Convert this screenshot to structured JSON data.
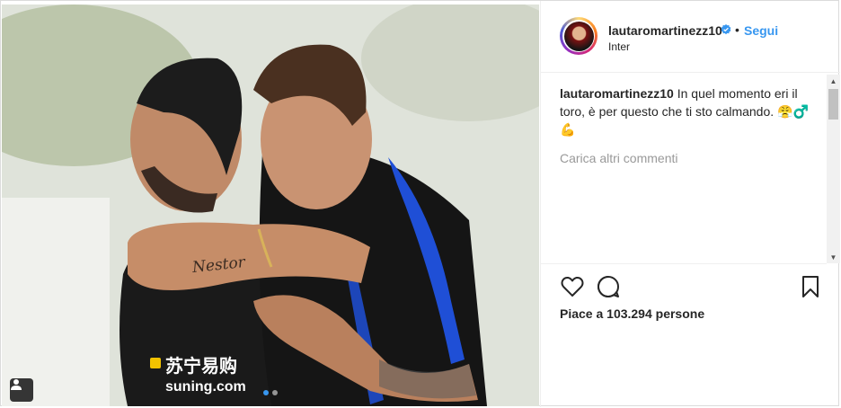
{
  "post": {
    "username": "lautaromartinezz10",
    "separator": "•",
    "follow_label": "Segui",
    "location": "Inter",
    "caption_user": "lautaromartinezz10",
    "caption_text": "In quel momento eri il toro, è per questo che ti sto calmando. 😤♂️ 💪",
    "load_more_label": "Carica altri commenti",
    "likes_label": "Piace a 103.294 persone",
    "jersey_sponsor": "苏宁易购",
    "jersey_sponsor_url": "suning.com",
    "tattoo_text": "Nestor"
  },
  "carousel": {
    "slides": 2,
    "active_index": 0
  },
  "icons": {
    "like": "heart-icon",
    "comment": "comment-icon",
    "save": "bookmark-icon",
    "verified": "verified-badge-icon",
    "tag": "user-tag-icon"
  },
  "colors": {
    "link_blue": "#3897f0",
    "text": "#262626",
    "muted": "#999999",
    "border": "#dbdbdb"
  }
}
